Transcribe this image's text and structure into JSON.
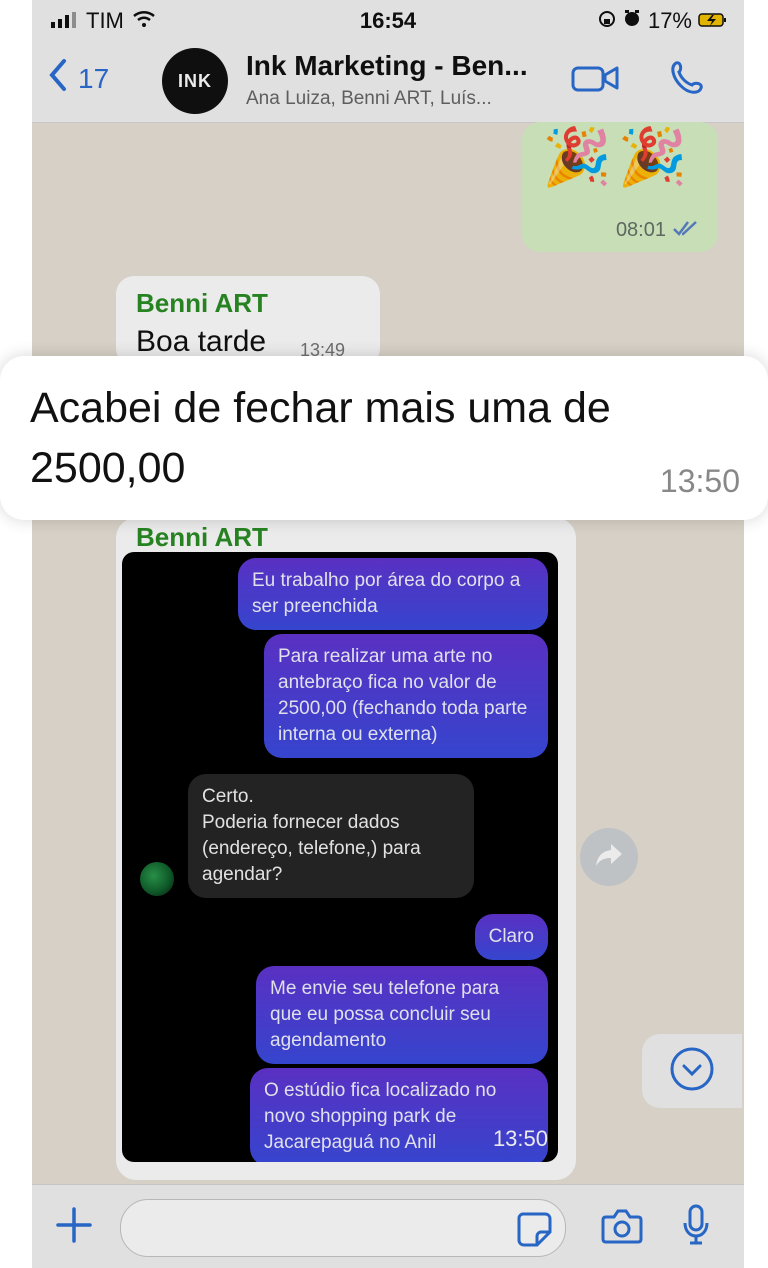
{
  "status": {
    "carrier": "TIM",
    "time": "16:54",
    "battery": "17%"
  },
  "header": {
    "back_count": "17",
    "avatar_text": "INK",
    "title": "Ink Marketing - Ben...",
    "subtitle": "Ana Luiza, Benni ART, Luís..."
  },
  "messages": {
    "outgoing_time": "08:01",
    "incoming_sender": "Benni ART",
    "incoming_text": "Boa tarde",
    "incoming_time": "13:49",
    "highlight_text": "Acabei de fechar mais uma de 2500,00",
    "highlight_time": "13:50",
    "screenshot_sender": "Benni ART",
    "screenshot_time": "13:50"
  },
  "screenshot": {
    "m1": "Eu trabalho por área do corpo a ser preenchida",
    "m2": "Para realizar uma arte no antebraço fica no valor de 2500,00 (fechando toda parte interna ou externa)",
    "m3": "Certo.\nPoderia fornecer dados (endereço, telefone,) para agendar?",
    "m4": "Claro",
    "m5": "Me envie seu telefone para que eu possa concluir seu agendamento",
    "m6": "O estúdio fica localizado no novo shopping park de Jacarepaguá no Anil"
  },
  "icons": {
    "signal": "signal-icon",
    "wifi": "wifi-icon",
    "lock": "lock-icon",
    "alarm": "alarm-icon",
    "battery": "battery-icon",
    "back": "back-chevron-icon",
    "video": "video-call-icon",
    "phone": "phone-call-icon",
    "forward": "forward-icon",
    "scroll": "chevron-down-icon",
    "plus": "plus-icon",
    "sticker": "sticker-icon",
    "camera": "camera-icon",
    "mic": "microphone-icon"
  },
  "colors": {
    "accent": "#2b6fd6",
    "sender": "#2b8f25",
    "outgoing": "#d8f1c7"
  }
}
